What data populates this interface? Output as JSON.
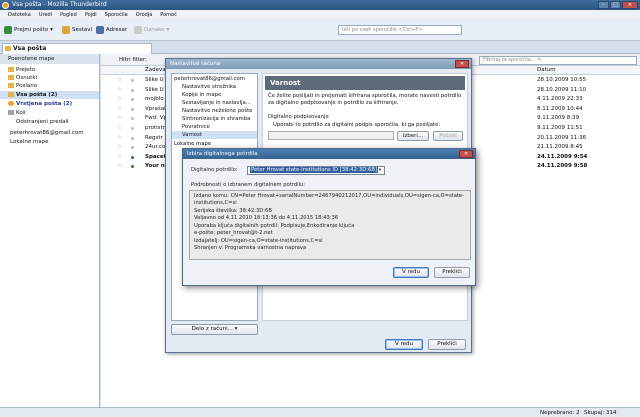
{
  "window": {
    "title": "Vsa pošta - Mozilla Thunderbird"
  },
  "menubar": [
    "Datoteka",
    "Uredi",
    "Pogled",
    "Pojdi",
    "Sporočila",
    "Orodja",
    "Pomoč"
  ],
  "toolbar": {
    "get_mail": "Prejmi pošto",
    "write": "Sestavi",
    "address_book": "Adresar",
    "tag": "Oznake",
    "search_placeholder": "Išči po vseh sporočilih <Ctrl+F>"
  },
  "tab": {
    "label": "Vsa pošta"
  },
  "folder_pane": {
    "header": "Poenotene mape",
    "items": [
      {
        "label": "Prejeto"
      },
      {
        "label": "Osnutki"
      },
      {
        "label": "Poslano"
      },
      {
        "label": "Vsa pošta (2)"
      },
      {
        "label": "Vrstjena pošta (2)"
      },
      {
        "label": "Koš"
      },
      {
        "label": "Odstranjeni predali"
      },
      {
        "label": "peterhrovat86@gmail.com"
      },
      {
        "label": "Lokalne mape"
      }
    ]
  },
  "message_list": {
    "filter_label": "Hitri filter:",
    "filter_placeholder": "Filtriraj ta sporočila... <",
    "col_subject": "Zadeva",
    "col_date": "Datum",
    "rows": [
      {
        "subject": "Slike U",
        "date": "28.10.2009 10:55"
      },
      {
        "subject": "Slike U",
        "date": "28.10.2009 11:10"
      },
      {
        "subject": "mojblo",
        "date": "4.11.2009 22:33"
      },
      {
        "subject": "Vprašal",
        "date": "8.11.2009 10:44"
      },
      {
        "subject": "Fwd: Vp",
        "date": "9.11.2009 8:39"
      },
      {
        "subject": "protistr",
        "date": "9.11.2009 11:51"
      },
      {
        "subject": "Regstr",
        "date": "20.11.2009 11:36"
      },
      {
        "subject": "24ur.co",
        "date": "21.11.2009 8:45"
      },
      {
        "subject": "Spacefl",
        "date": "24.11.2009 9:54"
      },
      {
        "subject": "Your n",
        "date": "24.11.2009 9:58"
      }
    ]
  },
  "account_dialog": {
    "title": "Nastavitve računa",
    "account": "peterhrovat86@gmail.com",
    "items": [
      "Nastavitve strežnika",
      "Kopije in mape",
      "Sestavljanje in naslavlja...",
      "Nastavitve neželene pošte",
      "Sinhronizacija in shramba",
      "Povratnice",
      "Varnost",
      "Lokalne mape",
      "Nastavitve neželene pošte",
      "Shramba diska",
      "Strežnik za odhodno p..."
    ],
    "section_title": "Varnost",
    "intro": "Če želite pošiljati in prejemati šifrirana sporočila, morate navesti potrdilo za digitalno podpisovanje in potrdilo za šifriranje.",
    "signing_heading": "Digitalno podpisovanje",
    "signing_label": "Uporabi to potrdilo za digitalni podpis sporočila, ki ga pošiljate:",
    "select_button": "Izberi...",
    "clear_button": "Počisti",
    "actions_button": "Delo z računi...",
    "ok_button": "V redu",
    "cancel_button": "Prekliči"
  },
  "cert_dialog": {
    "title": "Izbira digitalnega potrdila",
    "label": "Digitalno potrdilo:",
    "selected": "Peter Hrovat state-institutions ID [38:42:3D:6B]",
    "details_heading": "Podrobnosti o izbranem digitalnem potrdilu:",
    "details": [
      "Izdano komu: CN=Peter Hrovat+serialNumber=2467940212017,OU=individuals,OU=sigen-ca,O=state-",
      "institutions,C=si",
      "  Serijska številka: 38:42:3D:6B",
      "  Veljavno od 4.11.2010 18:13:36 do 4.11.2015 18:43:36",
      "  Uporaba ključa digitalnih potrdil: Podpisuje,Enkodiranje ključa",
      "  e-pošte: peter_hrovat@t-2.net",
      "Izdajatelj: OU=sigen-ca,O=state-institutions,C=si",
      "Shranjen v: Programska varnostna naprava"
    ],
    "ok_button": "V redu",
    "cancel_button": "Prekliči"
  },
  "status": {
    "unread": "Neprebrano: 2",
    "total": "Skupaj: 314"
  },
  "colors": {
    "accent": "#2f5f9e",
    "title_gradient": "#3f6d9c",
    "security_header": "#5c6a7a"
  }
}
